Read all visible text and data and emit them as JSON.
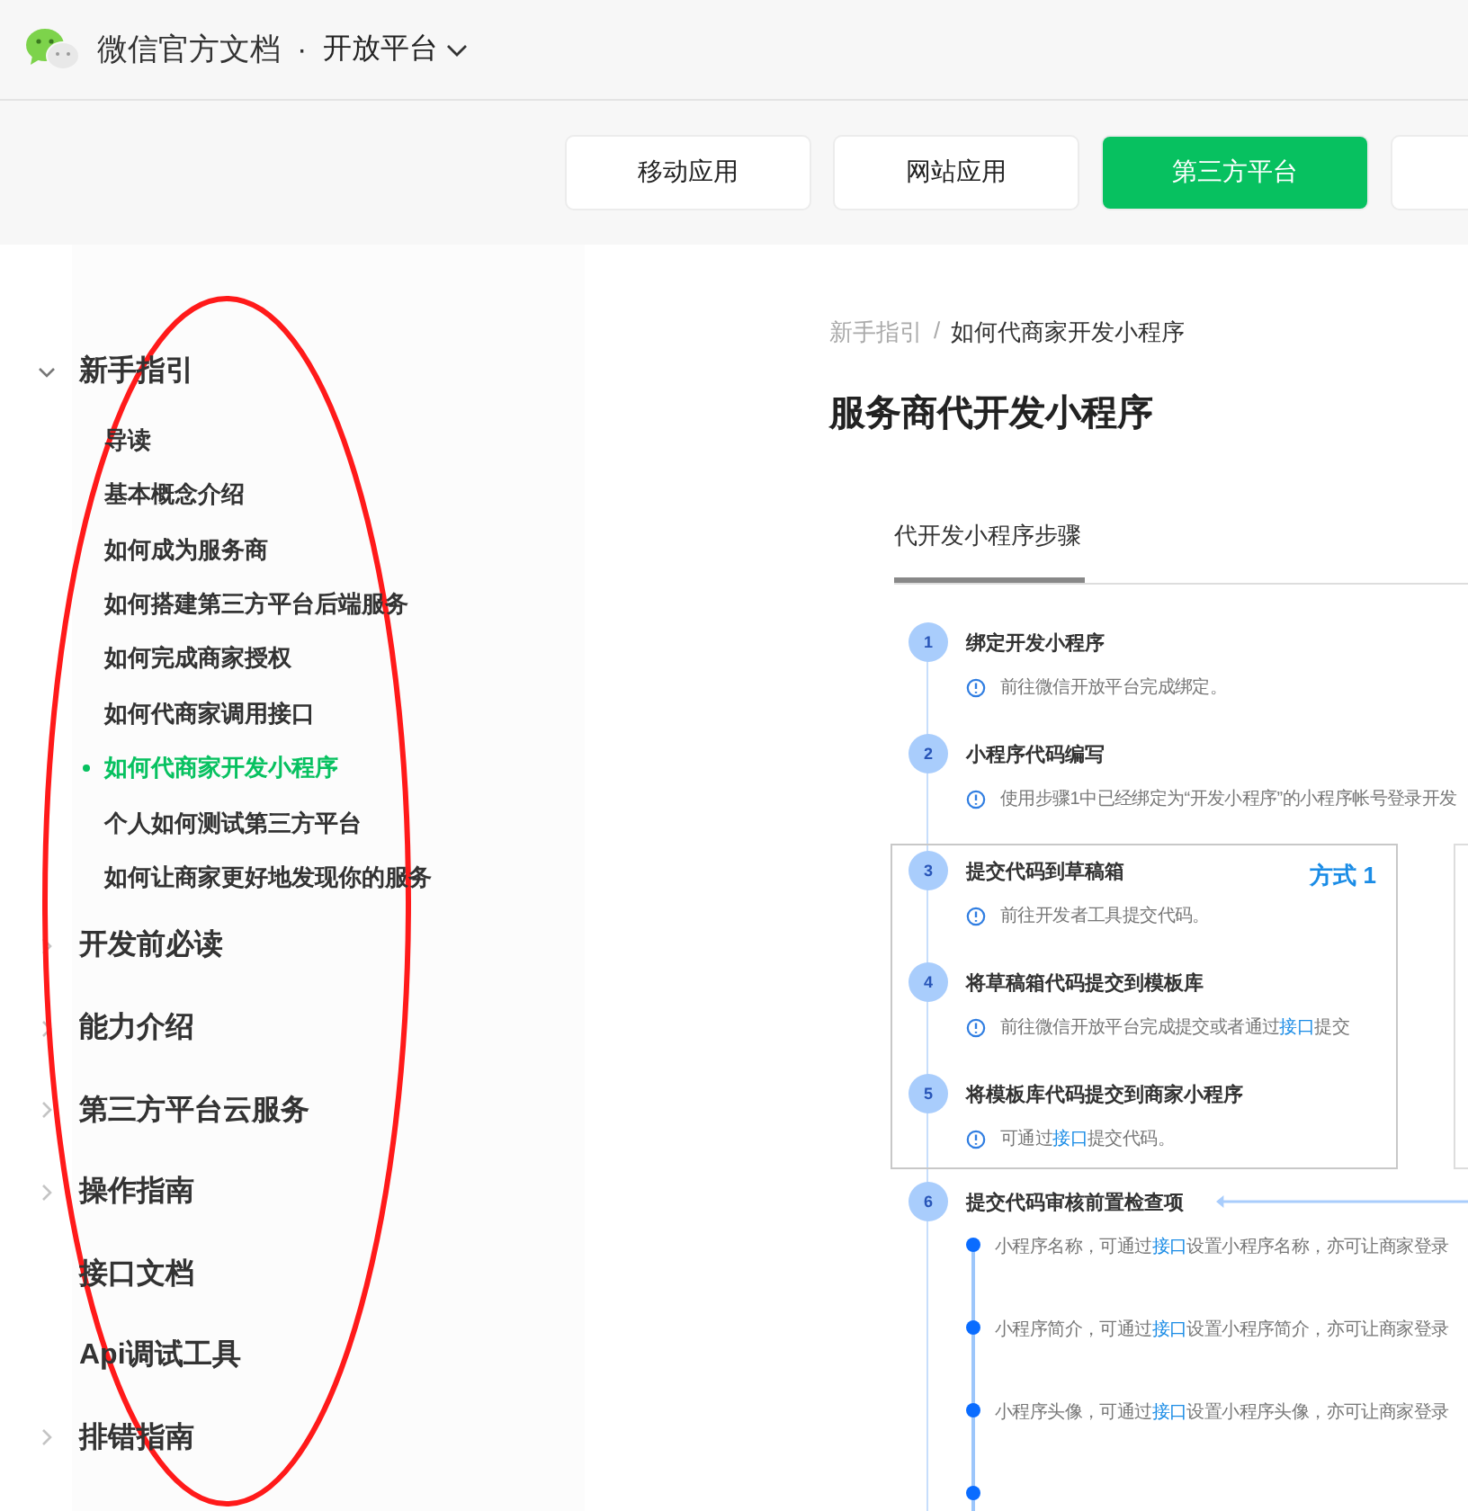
{
  "header": {
    "site_title": "微信官方文档",
    "separator": "·",
    "product": "开放平台"
  },
  "nav_buttons": [
    {
      "label": "移动应用",
      "selected": false
    },
    {
      "label": "网站应用",
      "selected": false
    },
    {
      "label": "第三方平台",
      "selected": true
    },
    {
      "selected": false
    }
  ],
  "sidebar": {
    "items": [
      {
        "kind": "group",
        "label": "新手指引",
        "expanded": true,
        "children": [
          {
            "label": "导读",
            "selected": false
          },
          {
            "label": "基本概念介绍",
            "selected": false
          },
          {
            "label": "如何成为服务商",
            "selected": false
          },
          {
            "label": "如何搭建第三方平台后端服务",
            "selected": false
          },
          {
            "label": "如何完成商家授权",
            "selected": false
          },
          {
            "label": "如何代商家调用接口",
            "selected": false
          },
          {
            "label": "如何代商家开发小程序",
            "selected": true
          },
          {
            "label": "个人如何测试第三方平台",
            "selected": false
          },
          {
            "label": "如何让商家更好地发现你的服务",
            "selected": false
          }
        ]
      },
      {
        "kind": "group",
        "label": "开发前必读",
        "expanded": false
      },
      {
        "kind": "group",
        "label": "能力介绍",
        "expanded": false
      },
      {
        "kind": "group",
        "label": "第三方平台云服务",
        "expanded": false
      },
      {
        "kind": "group",
        "label": "操作指南",
        "expanded": false
      },
      {
        "kind": "page",
        "label": "接口文档"
      },
      {
        "kind": "page",
        "label": "Api调试工具"
      },
      {
        "kind": "group",
        "label": "排错指南",
        "expanded": false
      }
    ]
  },
  "breadcrumb": [
    "新手指引",
    "/",
    "如何代商家开发小程序"
  ],
  "title": "服务商代开发小程序",
  "tabs": [
    {
      "label": "代开发小程序步骤",
      "selected": true
    }
  ],
  "steps": [
    {
      "kind": "step",
      "number": "1",
      "title": "绑定开发小程序",
      "note": [
        {
          "text": "前往微信开放平台完成绑定。"
        }
      ]
    },
    {
      "kind": "step",
      "number": "2",
      "title": "小程序代码编写",
      "note": [
        {
          "text": "使用步骤1中已经绑定为“开发小程序”的小程序帐号登录开发"
        }
      ]
    },
    {
      "kind": "group",
      "label": "方式 1",
      "steps": [
        {
          "kind": "step",
          "number": "3",
          "title": "提交代码到草稿箱",
          "note": [
            {
              "text": "前往开发者工具提交代码。"
            }
          ]
        },
        {
          "kind": "step",
          "number": "4",
          "title": "将草稿箱代码提交到模板库",
          "note": [
            {
              "text": "前往微信开放平台完成提交或者通过"
            },
            {
              "text": "接口",
              "link": true
            },
            {
              "text": "提交"
            }
          ]
        },
        {
          "kind": "step",
          "number": "5",
          "title": "将模板库代码提交到商家小程序",
          "note": [
            {
              "text": "可通过"
            },
            {
              "text": "接口",
              "link": true
            },
            {
              "text": "提交代码。"
            }
          ]
        }
      ]
    },
    {
      "kind": "checklist",
      "number": "6",
      "title": "提交代码审核前置检查项",
      "items": [
        [
          {
            "text": "小程序名称，可通过"
          },
          {
            "text": "接口",
            "link": true
          },
          {
            "text": "设置小程序名称，亦可让商家登录"
          }
        ],
        [
          {
            "text": "小程序简介，可通过"
          },
          {
            "text": "接口",
            "link": true
          },
          {
            "text": "设置小程序简介，亦可让商家登录"
          }
        ],
        [
          {
            "text": "小程序头像，可通过"
          },
          {
            "text": "接口",
            "link": true
          },
          {
            "text": "设置小程序头像，亦可让商家登录"
          }
        ]
      ]
    }
  ]
}
